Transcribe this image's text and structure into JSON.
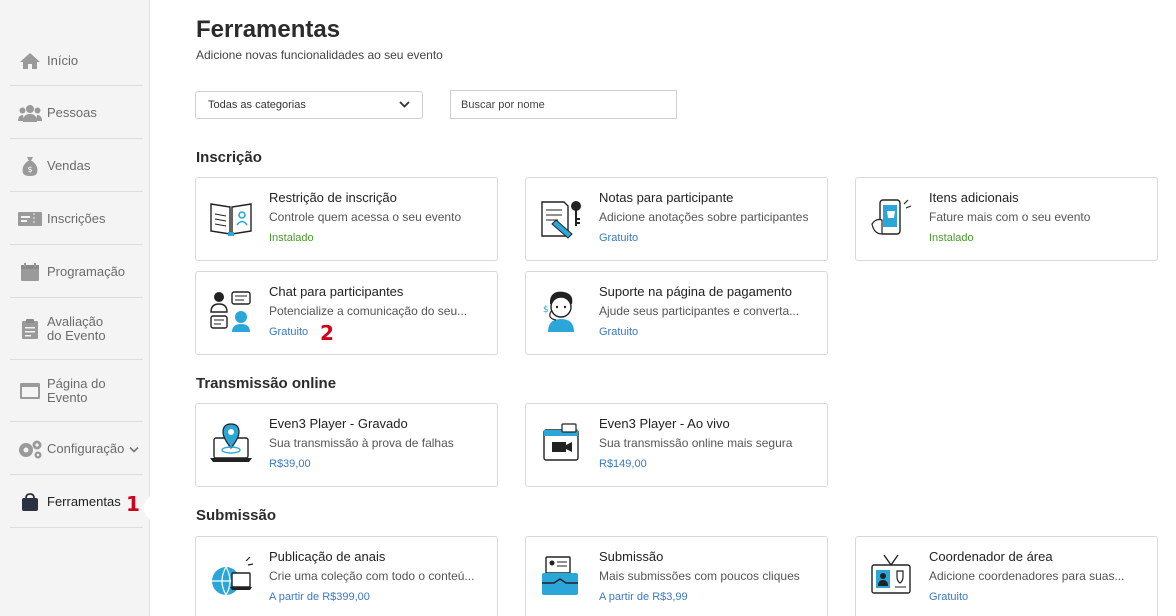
{
  "sidebar": {
    "items": [
      {
        "label": "Início",
        "icon": "home-icon"
      },
      {
        "label": "Pessoas",
        "icon": "people-icon"
      },
      {
        "label": "Vendas",
        "icon": "money-bag-icon"
      },
      {
        "label": "Inscrições",
        "icon": "ticket-icon"
      },
      {
        "label": "Programação",
        "icon": "calendar-icon"
      },
      {
        "label": "Avaliação do Evento",
        "icon": "clipboard-icon"
      },
      {
        "label": "Página do Evento",
        "icon": "browser-window-icon"
      },
      {
        "label": "Configuração",
        "icon": "gears-icon"
      },
      {
        "label": "Ferramentas",
        "icon": "bag-icon"
      }
    ],
    "step_marker": "1"
  },
  "page": {
    "title": "Ferramentas",
    "subtitle": "Adicione novas funcionalidades ao seu evento"
  },
  "filters": {
    "category_selected": "Todas as categorias",
    "search_placeholder": "Buscar por nome"
  },
  "sections": {
    "inscricao": {
      "title": "Inscrição",
      "cards": [
        {
          "title": "Restrição de inscrição",
          "desc": "Controle quem acessa o seu evento",
          "price": "Instalado"
        },
        {
          "title": "Notas para participante",
          "desc": "Adicione anotações sobre participantes",
          "price": "Gratuito"
        },
        {
          "title": "Itens adicionais",
          "desc": "Fature mais com o seu evento",
          "price": "Instalado"
        },
        {
          "title": "Chat para participantes",
          "desc": "Potencialize a comunicação do seu...",
          "price": "Gratuito"
        },
        {
          "title": "Suporte na página de pagamento",
          "desc": "Ajude seus participantes e converta...",
          "price": "Gratuito"
        }
      ],
      "step_marker": "2"
    },
    "transmissao": {
      "title": "Transmissão online",
      "cards": [
        {
          "title": "Even3 Player - Gravado",
          "desc": "Sua transmissão à prova de falhas",
          "price": "R$39,00"
        },
        {
          "title": "Even3 Player - Ao vivo",
          "desc": "Sua transmissão online mais segura",
          "price": "R$149,00"
        }
      ]
    },
    "submissao": {
      "title": "Submissão",
      "cards": [
        {
          "title": "Publicação de anais",
          "desc": "Crie uma coleção com todo o conteú...",
          "price": "A partir de R$399,00"
        },
        {
          "title": "Submissão",
          "desc": "Mais submissões com poucos cliques",
          "price": "A partir de R$3,99"
        },
        {
          "title": "Coordenador de área",
          "desc": "Adicione coordenadores para suas...",
          "price": "Gratuito"
        }
      ]
    }
  },
  "colors": {
    "accent_blue": "#3a78c2",
    "installed_green": "#4a9a2f",
    "marker_red": "#d0021b",
    "illustration_blue": "#2aa7d8"
  }
}
